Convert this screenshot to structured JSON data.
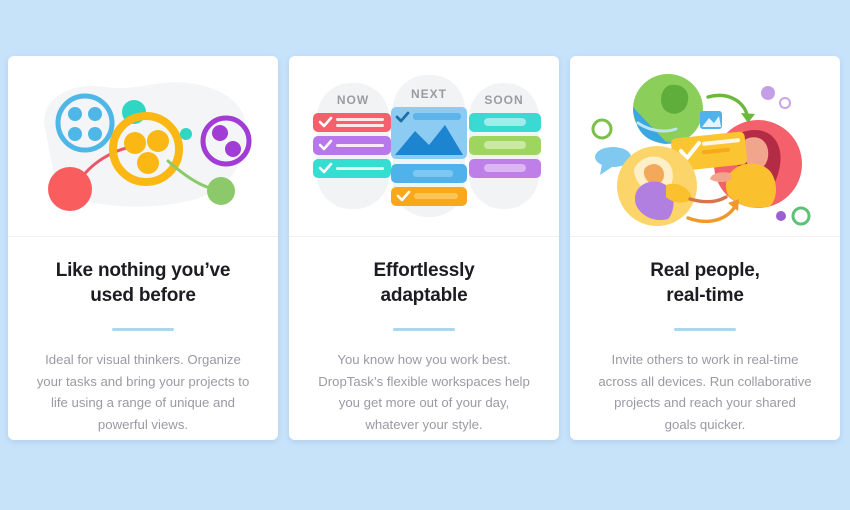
{
  "page": {
    "background_color": "#c7e3fa",
    "card_background": "#ffffff",
    "accent_color": "#a8d8ef",
    "title_color": "#1c1c22",
    "description_color": "#9a9aa2"
  },
  "cards": [
    {
      "id": "visual-thinkers",
      "title": "Like nothing you’ve\nused before",
      "description": "Ideal for visual thinkers. Organize your tasks and bring your projects to life using a range of unique and powerful views.",
      "illustration": {
        "name": "radial-views-illustration",
        "colors": {
          "blob": "#f4f5f6",
          "blue": "#4fb6e8",
          "yellow": "#fbb713",
          "purple": "#a13cd4",
          "red": "#fa5d5d",
          "green": "#8cc96a",
          "teal": "#2fd6c3"
        }
      }
    },
    {
      "id": "adaptable",
      "title": "Effortlessly\nadaptable",
      "description": "You know how you work best. DropTask’s flexible workspaces help you get more out of your day, whatever your style.",
      "illustration": {
        "name": "kanban-board-illustration",
        "columns": [
          {
            "label": "NOW",
            "tasks": [
              {
                "color": "#f4606b",
                "checked": true
              },
              {
                "color": "#b878ec",
                "checked": true
              },
              {
                "color": "#35ded0",
                "checked": true
              }
            ]
          },
          {
            "label": "NEXT",
            "tasks": [
              {
                "color": "#6fc0ee",
                "checked": true,
                "has_image": true
              },
              {
                "color": "#4fb2ea",
                "checked": false
              },
              {
                "color": "#f9a81b",
                "checked": true
              }
            ]
          },
          {
            "label": "SOON",
            "tasks": [
              {
                "color": "#3ad9d2",
                "checked": false
              },
              {
                "color": "#9ed55e",
                "checked": false
              },
              {
                "color": "#bf7fe8",
                "checked": false
              }
            ]
          }
        ],
        "colors": {
          "column_blob": "#f2f3f4",
          "label_text": "#9b9ba3"
        }
      }
    },
    {
      "id": "real-time",
      "title": "Real people,\nreal-time",
      "description": "Invite others to work in real-time across all devices. Run collaborative projects and reach your shared goals quicker.",
      "illustration": {
        "name": "collaboration-people-illustration",
        "colors": {
          "globe_green": "#8bce5a",
          "globe_blue": "#3aa7e0",
          "globe_land": "#5fae3c",
          "person_pink": "#f4606b",
          "hair_dark_red": "#b32b44",
          "skin": "#f0a58c",
          "yellow": "#fbc02d",
          "card_yellow": "#fbc531",
          "purple_dot": "#b07fe0",
          "green_ring": "#7cc04a",
          "blue_speech": "#7fc8ef",
          "arrow_green": "#6cb83f",
          "arrow_orange": "#f0992a",
          "top_yellow": "#fcd56a"
        }
      }
    }
  ]
}
